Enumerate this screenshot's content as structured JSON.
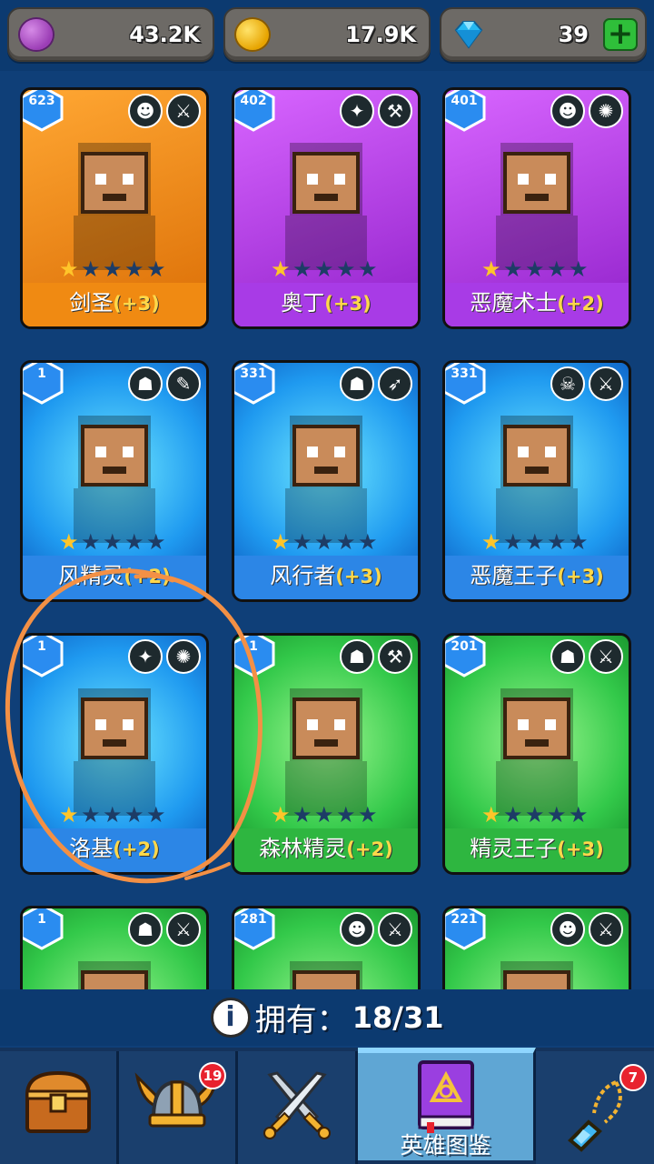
{
  "currencies": [
    {
      "name": "elixir",
      "value": "43.2K",
      "icon": "purple-coin-icon"
    },
    {
      "name": "gold",
      "value": "17.9K",
      "icon": "gold-coin-icon"
    },
    {
      "name": "gems",
      "value": "39",
      "icon": "gem-icon",
      "action": "+"
    }
  ],
  "heroes": [
    {
      "level": "623",
      "name": "剑圣",
      "bonus": "(+3)",
      "rarity": "orange",
      "stars": 1,
      "class_icons": [
        "orc-icon",
        "sword-icon"
      ]
    },
    {
      "level": "402",
      "name": "奥丁",
      "bonus": "(+3)",
      "rarity": "purple",
      "stars": 1,
      "class_icons": [
        "winged-icon",
        "hammer-icon"
      ]
    },
    {
      "level": "401",
      "name": "恶魔术士",
      "bonus": "(+2)",
      "rarity": "purple",
      "stars": 1,
      "class_icons": [
        "orc-icon",
        "magic-icon"
      ]
    },
    {
      "level": "1",
      "name": "风精灵",
      "bonus": "(+2)",
      "rarity": "blue",
      "stars": 1,
      "class_icons": [
        "elf-icon",
        "staff-icon"
      ]
    },
    {
      "level": "331",
      "name": "风行者",
      "bonus": "(+3)",
      "rarity": "blue",
      "stars": 1,
      "class_icons": [
        "elf-icon",
        "bow-icon"
      ]
    },
    {
      "level": "331",
      "name": "恶魔王子",
      "bonus": "(+3)",
      "rarity": "blue",
      "stars": 1,
      "class_icons": [
        "demon-icon",
        "sword-icon"
      ]
    },
    {
      "level": "1",
      "name": "洛基",
      "bonus": "(+2)",
      "rarity": "blue",
      "stars": 1,
      "class_icons": [
        "winged-icon",
        "magic-icon"
      ]
    },
    {
      "level": "1",
      "name": "森林精灵",
      "bonus": "(+2)",
      "rarity": "green",
      "stars": 1,
      "class_icons": [
        "elf-icon",
        "hammer-icon"
      ]
    },
    {
      "level": "201",
      "name": "精灵王子",
      "bonus": "(+3)",
      "rarity": "green",
      "stars": 1,
      "class_icons": [
        "elf-icon",
        "sword-icon"
      ]
    },
    {
      "level": "1",
      "name": "",
      "bonus": "",
      "rarity": "green",
      "stars": 1,
      "class_icons": [
        "elf-icon",
        "sword-icon"
      ]
    },
    {
      "level": "281",
      "name": "",
      "bonus": "",
      "rarity": "green",
      "stars": 1,
      "class_icons": [
        "orc-icon",
        "sword-icon"
      ]
    },
    {
      "level": "221",
      "name": "",
      "bonus": "",
      "rarity": "green",
      "stars": 1,
      "class_icons": [
        "orc-icon",
        "sword-icon"
      ]
    }
  ],
  "owned": {
    "label": "拥有：",
    "count": "18/31"
  },
  "nav": [
    {
      "name": "chest",
      "label": "",
      "icon": "treasure-chest-icon",
      "badge": ""
    },
    {
      "name": "heroes",
      "label": "",
      "icon": "viking-helmet-icon",
      "badge": "19"
    },
    {
      "name": "battle",
      "label": "",
      "icon": "crossed-swords-icon",
      "badge": ""
    },
    {
      "name": "hero-codex",
      "label": "英雄图鉴",
      "icon": "book-icon",
      "badge": ""
    },
    {
      "name": "items",
      "label": "",
      "icon": "amulet-icon",
      "badge": "7"
    }
  ]
}
